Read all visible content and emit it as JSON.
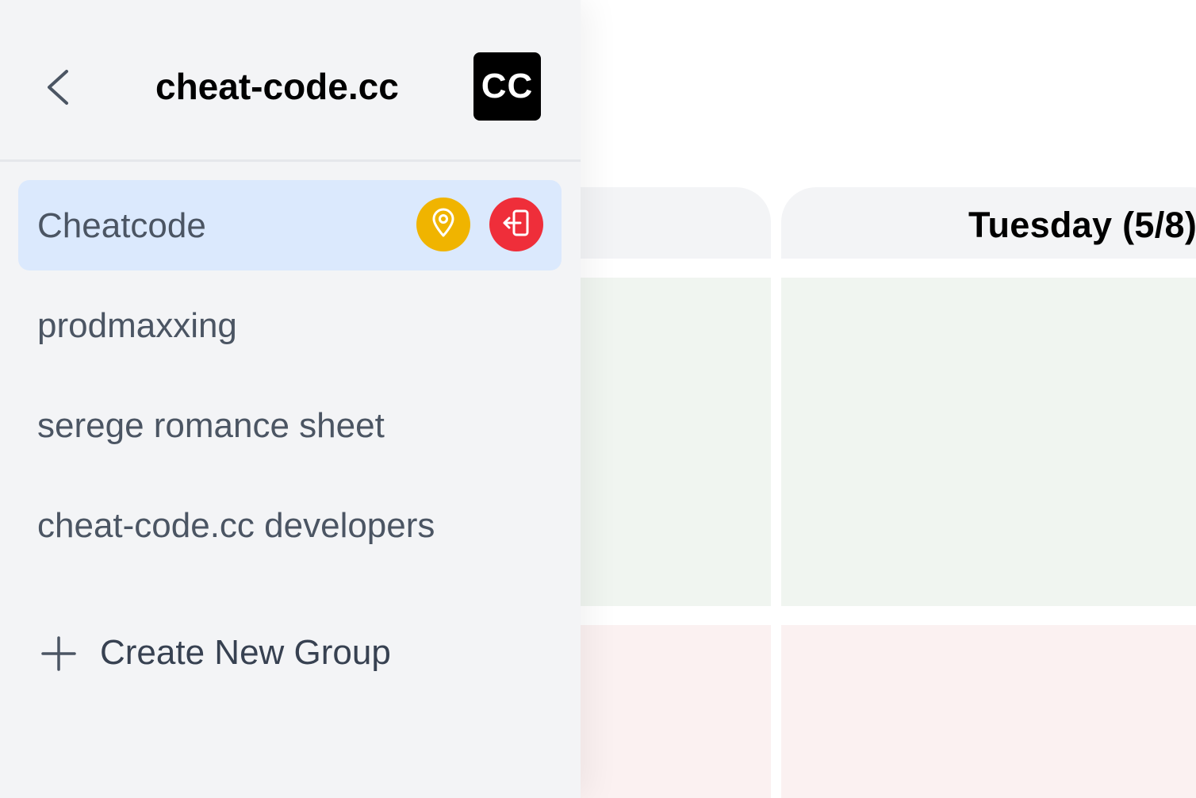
{
  "sidebar": {
    "title": "cheat-code.cc",
    "logo_text": "CC",
    "groups": [
      {
        "label": "Cheatcode",
        "active": true
      },
      {
        "label": "prodmaxxing",
        "active": false
      },
      {
        "label": "serege romance sheet",
        "active": false
      },
      {
        "label": "cheat-code.cc developers",
        "active": false
      }
    ],
    "create_label": "Create New Group",
    "icons": {
      "back": "chevron-left-icon",
      "location": "map-pin-icon",
      "leave": "exit-door-icon",
      "create": "plus-icon"
    }
  },
  "calendar": {
    "days": [
      {
        "label": ""
      },
      {
        "label": "Tuesday (5/8)"
      }
    ]
  },
  "colors": {
    "active_bg": "#dbe9fd",
    "location_button": "#f0b400",
    "leave_button": "#ef2e3a",
    "available_cell": "#f0f5f0",
    "busy_cell": "#fbf1f1",
    "panel_bg": "#f3f4f6"
  }
}
